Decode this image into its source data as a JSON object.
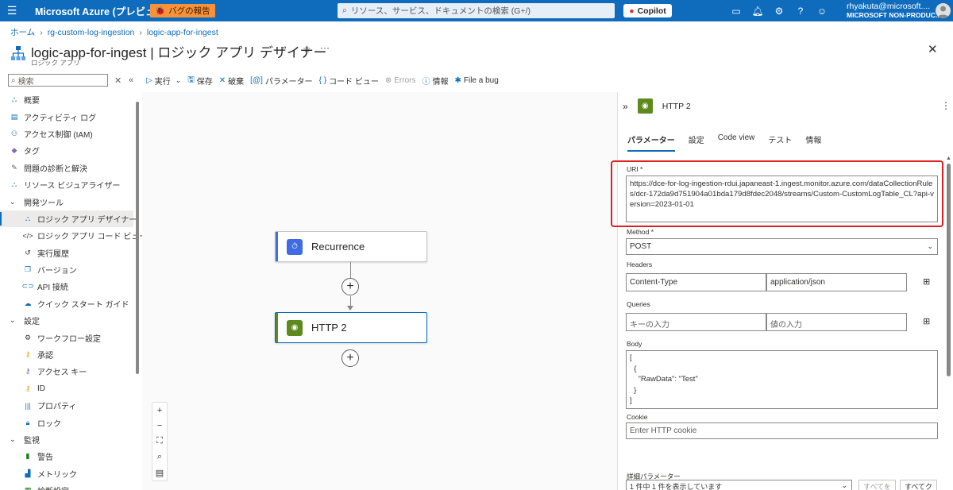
{
  "topbar": {
    "brand": "Microsoft Azure (プレビュー)",
    "bug_report": "バグの報告",
    "search_placeholder": "リソース、サービス、ドキュメントの検索 (G+/)",
    "copilot": "Copilot",
    "icons": [
      "terminal-icon",
      "bell-icon",
      "gear-icon",
      "help-icon",
      "feedback-icon"
    ],
    "user": "rhyakuta@microsoft....",
    "tenant": "MICROSOFT NON-PRODUC..."
  },
  "breadcrumb": [
    "ホーム",
    "rg-custom-log-ingestion",
    "logic-app-for-ingest"
  ],
  "page": {
    "title": "logic-app-for-ingest | ロジック アプリ デザイナー",
    "subtitle": "ロジック アプリ"
  },
  "sidebar": {
    "search_placeholder": "検索",
    "items": [
      {
        "label": "概要",
        "icon": "overview-icon",
        "level": 0
      },
      {
        "label": "アクティビティ ログ",
        "icon": "activity-log-icon",
        "level": 0
      },
      {
        "label": "アクセス制御 (IAM)",
        "icon": "iam-icon",
        "level": 0
      },
      {
        "label": "タグ",
        "icon": "tag-icon",
        "level": 0
      },
      {
        "label": "問題の診断と解決",
        "icon": "wrench-icon",
        "level": 0
      },
      {
        "label": "リソース ビジュアライザー",
        "icon": "visualizer-icon",
        "level": 0
      },
      {
        "label": "開発ツール",
        "icon": "chevron-down-icon",
        "level": 0,
        "group": true
      },
      {
        "label": "ロジック アプリ デザイナー",
        "icon": "designer-icon",
        "level": 1,
        "active": true
      },
      {
        "label": "ロジック アプリ コード ビュー",
        "icon": "code-icon",
        "level": 1
      },
      {
        "label": "実行履歴",
        "icon": "history-icon",
        "level": 1
      },
      {
        "label": "バージョン",
        "icon": "versions-icon",
        "level": 1
      },
      {
        "label": "API 接続",
        "icon": "api-icon",
        "level": 1
      },
      {
        "label": "クイック スタート ガイド",
        "icon": "quickstart-icon",
        "level": 1
      },
      {
        "label": "設定",
        "icon": "chevron-down-icon",
        "level": 0,
        "group": true
      },
      {
        "label": "ワークフロー設定",
        "icon": "gear-icon",
        "level": 1
      },
      {
        "label": "承認",
        "icon": "key-icon",
        "level": 1
      },
      {
        "label": "アクセス キー",
        "icon": "access-key-icon",
        "level": 1
      },
      {
        "label": "ID",
        "icon": "identity-icon",
        "level": 1
      },
      {
        "label": "プロパティ",
        "icon": "properties-icon",
        "level": 1
      },
      {
        "label": "ロック",
        "icon": "lock-icon",
        "level": 1
      },
      {
        "label": "監視",
        "icon": "chevron-down-icon",
        "level": 0,
        "group": true
      },
      {
        "label": "警告",
        "icon": "alert-icon",
        "level": 1
      },
      {
        "label": "メトリック",
        "icon": "metrics-icon",
        "level": 1
      },
      {
        "label": "診断設定",
        "icon": "diagnostics-icon",
        "level": 1
      }
    ]
  },
  "toolbar": {
    "run": "実行",
    "save": "保存",
    "discard": "破棄",
    "parameters": "パラメーター",
    "code_view": "コード ビュー",
    "errors": "Errors",
    "info": "情報",
    "file_bug": "File a bug"
  },
  "canvas": {
    "nodes": [
      {
        "label": "Recurrence",
        "accent": "#3f6ce4"
      },
      {
        "label": "HTTP 2",
        "accent": "#5c8a1e"
      }
    ]
  },
  "panel": {
    "title": "HTTP 2",
    "tabs": [
      "パラメーター",
      "設定",
      "Code view",
      "テスト",
      "情報"
    ],
    "uri_label": "URI *",
    "uri_value": "https://dce-for-log-ingestion-rdui.japaneast-1.ingest.monitor.azure.com/dataCollectionRules/dcr-172da9d751904a01bda179d8fdec2048/streams/Custom-CustomLogTable_CL?api-version=2023-01-01",
    "method_label": "Method *",
    "method_value": "POST",
    "headers_label": "Headers",
    "header_key": "Content-Type",
    "header_value": "application/json",
    "queries_label": "Queries",
    "query_key_placeholder": "キーの入力",
    "query_value_placeholder": "値の入力",
    "body_label": "Body",
    "body_value": "[\n  {\n    \"RawData\": \"Test\"\n  }\n]",
    "cookie_label": "Cookie",
    "cookie_placeholder": "Enter HTTP cookie",
    "advanced_label": "詳細パラメーター",
    "advanced_select": "1 件中 1 件を表示しています",
    "show_all": "すべてを",
    "clear_all": "すべてク"
  }
}
